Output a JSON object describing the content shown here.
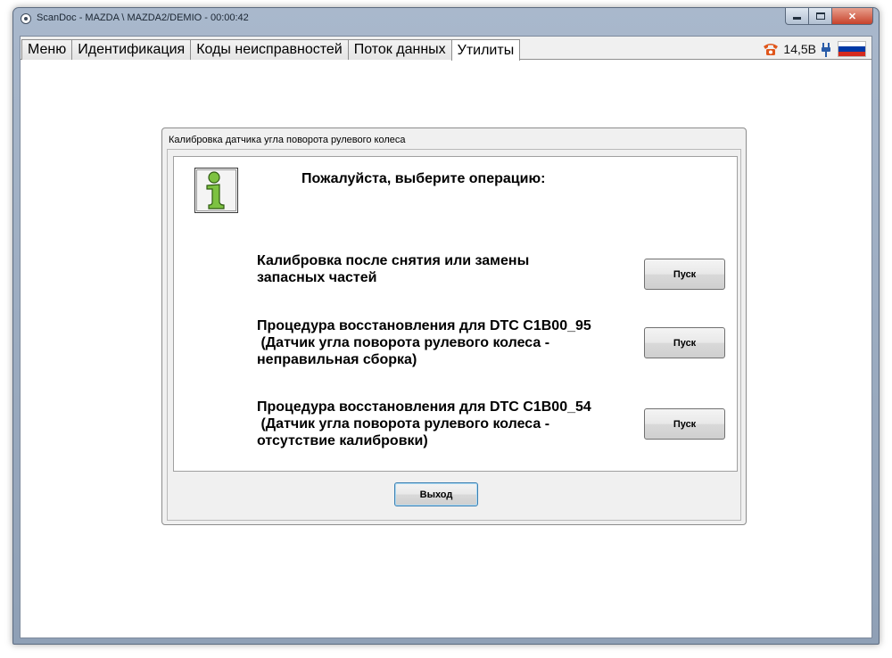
{
  "window": {
    "title": "ScanDoc - MAZDA \\ MAZDA2/DEMIO - 00:00:42"
  },
  "tabs": [
    {
      "label": "Меню",
      "active": false
    },
    {
      "label": "Идентификация",
      "active": false
    },
    {
      "label": "Коды неисправностей",
      "active": false
    },
    {
      "label": "Поток данных",
      "active": false
    },
    {
      "label": "Утилиты",
      "active": true
    }
  ],
  "status": {
    "voltage": "14,5В",
    "icons": [
      "phone-icon",
      "plug-icon",
      "russia-flag-icon"
    ]
  },
  "dialog": {
    "title": "Калибровка датчика угла поворота рулевого колеса",
    "prompt": "Пожалуйста, выберите операцию:",
    "operations": [
      {
        "text": "Калибровка после снятия или замены\nзапасных частей",
        "button": "Пуск"
      },
      {
        "text": "Процедура восстановления для DTC C1B00_95\n (Датчик угла поворота рулевого колеса -\nнеправильная сборка)",
        "button": "Пуск"
      },
      {
        "text": "Процедура восстановления для DTC C1B00_54\n (Датчик угла поворота рулевого колеса -\nотсутствие калибровки)",
        "button": "Пуск"
      }
    ],
    "exit_label": "Выход"
  },
  "colors": {
    "info_icon_green": "#7dc241",
    "phone_orange": "#e0561b",
    "flag_white": "#ffffff",
    "flag_blue": "#0039a6",
    "flag_red": "#d52b1e"
  }
}
